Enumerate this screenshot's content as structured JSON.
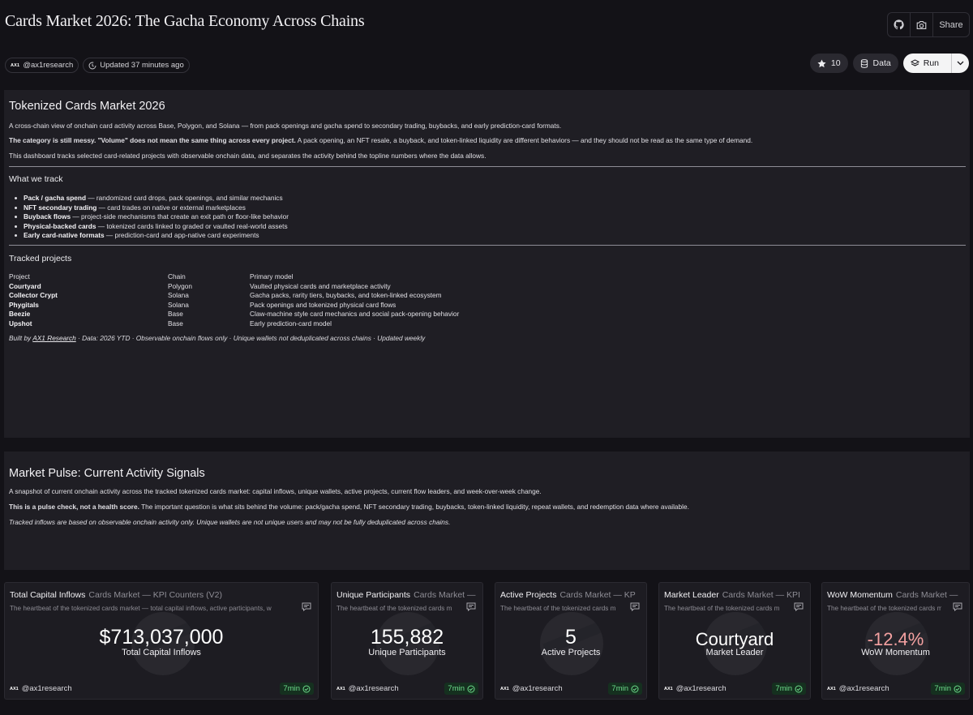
{
  "header": {
    "title": "Cards Market 2026: The Gacha Economy Across Chains",
    "tools": {
      "github_icon": "github-icon",
      "camera_icon": "camera-icon",
      "share_label": "Share"
    },
    "author": "@ax1research",
    "author_logo": "AX1",
    "updated": "Updated 37 minutes ago",
    "stars": "10",
    "data_label": "Data",
    "run_label": "Run"
  },
  "intro": {
    "title": "Tokenized Cards Market 2026",
    "p1": "A cross-chain view of onchain card activity across Base, Polygon, and Solana — from pack openings and gacha spend to secondary trading, buybacks, and early prediction-card formats.",
    "p2_lead": "The category is still messy. \"Volume\" does not mean the same thing across every project.",
    "p2_rest": " A pack opening, an NFT resale, a buyback, and token-linked liquidity are different behaviors — and they should not be read as the same type of demand.",
    "p3": "This dashboard tracks selected card-related projects with observable onchain data, and separates the activity behind the topline numbers where the data allows.",
    "track_heading": "What we track",
    "track_items": [
      {
        "b": "Pack / gacha spend",
        "t": " — randomized card drops, pack openings, and similar mechanics"
      },
      {
        "b": "NFT secondary trading",
        "t": " — card trades on native or external marketplaces"
      },
      {
        "b": "Buyback flows",
        "t": " — project-side mechanisms that create an exit path or floor-like behavior"
      },
      {
        "b": "Physical-backed cards",
        "t": " — tokenized cards linked to graded or vaulted real-world assets"
      },
      {
        "b": "Early card-native formats",
        "t": " — prediction-card and app-native card experiments"
      }
    ],
    "projects_heading": "Tracked projects",
    "projects_header": [
      "Project",
      "Chain",
      "Primary model"
    ],
    "projects": [
      [
        "Courtyard",
        "Polygon",
        "Vaulted physical cards and marketplace activity"
      ],
      [
        "Collector Crypt",
        "Solana",
        "Gacha packs, rarity tiers, buybacks, and token-linked ecosystem"
      ],
      [
        "Phygitals",
        "Solana",
        "Pack openings and tokenized physical card flows"
      ],
      [
        "Beezie",
        "Base",
        "Claw-machine style card mechanics and social pack-opening behavior"
      ],
      [
        "Upshot",
        "Base",
        "Early prediction-card model"
      ]
    ],
    "foot_pre": "Built by ",
    "foot_link": "AX1 Research",
    "foot_post": " · Data: 2026 YTD · Observable onchain flows only · Unique wallets not deduplicated across chains · Updated weekly"
  },
  "pulse": {
    "title": "Market Pulse: Current Activity Signals",
    "p1": "A snapshot of current onchain activity across the tracked tokenized cards market: capital inflows, unique wallets, active projects, current flow leaders, and week-over-week change.",
    "p2_lead": "This is a pulse check, not a health score.",
    "p2_rest": " The important question is what sits behind the volume: pack/gacha spend, NFT secondary trading, buybacks, token-linked liquidity, repeat wallets, and redemption data where available.",
    "p3": "Tracked inflows are based on observable onchain activity only. Unique wallets are not unique users and may not be fully deduplicated across chains."
  },
  "kpis": [
    {
      "title": "Total Capital Inflows",
      "sub": "Cards Market — KPI Counters (V2)",
      "desc": "The heartbeat of the tokenized cards market — total capital inflows, active participants, w",
      "value": "$713,037,000",
      "label": "Total Capital Inflows",
      "author": "@ax1research",
      "age": "7min"
    },
    {
      "title": "Unique Participants",
      "sub": "Cards Market —",
      "desc": "The heartbeat of the tokenized cards m",
      "value": "155,882",
      "label": "Unique Participants",
      "author": "@ax1research",
      "age": "7min"
    },
    {
      "title": "Active Projects",
      "sub": "Cards Market — KP",
      "desc": "The heartbeat of the tokenized cards m",
      "value": "5",
      "label": "Active Projects",
      "author": "@ax1research",
      "age": "7min"
    },
    {
      "title": "Market Leader",
      "sub": "Cards Market — KPI",
      "desc": "The heartbeat of the tokenized cards m",
      "value": "Courtyard",
      "label": "Market Leader",
      "author": "@ax1research",
      "age": "7min"
    },
    {
      "title": "WoW Momentum",
      "sub": "Cards Market —",
      "desc": "The heartbeat of the tokenized cards m",
      "value": "-12.4%",
      "label": "WoW Momentum",
      "author": "@ax1research",
      "age": "7min"
    }
  ],
  "colors": {
    "background": "#131217",
    "panel": "#1f1e24",
    "negative": "#f4a1a1",
    "fresh_badge": "#6ddc8b"
  }
}
